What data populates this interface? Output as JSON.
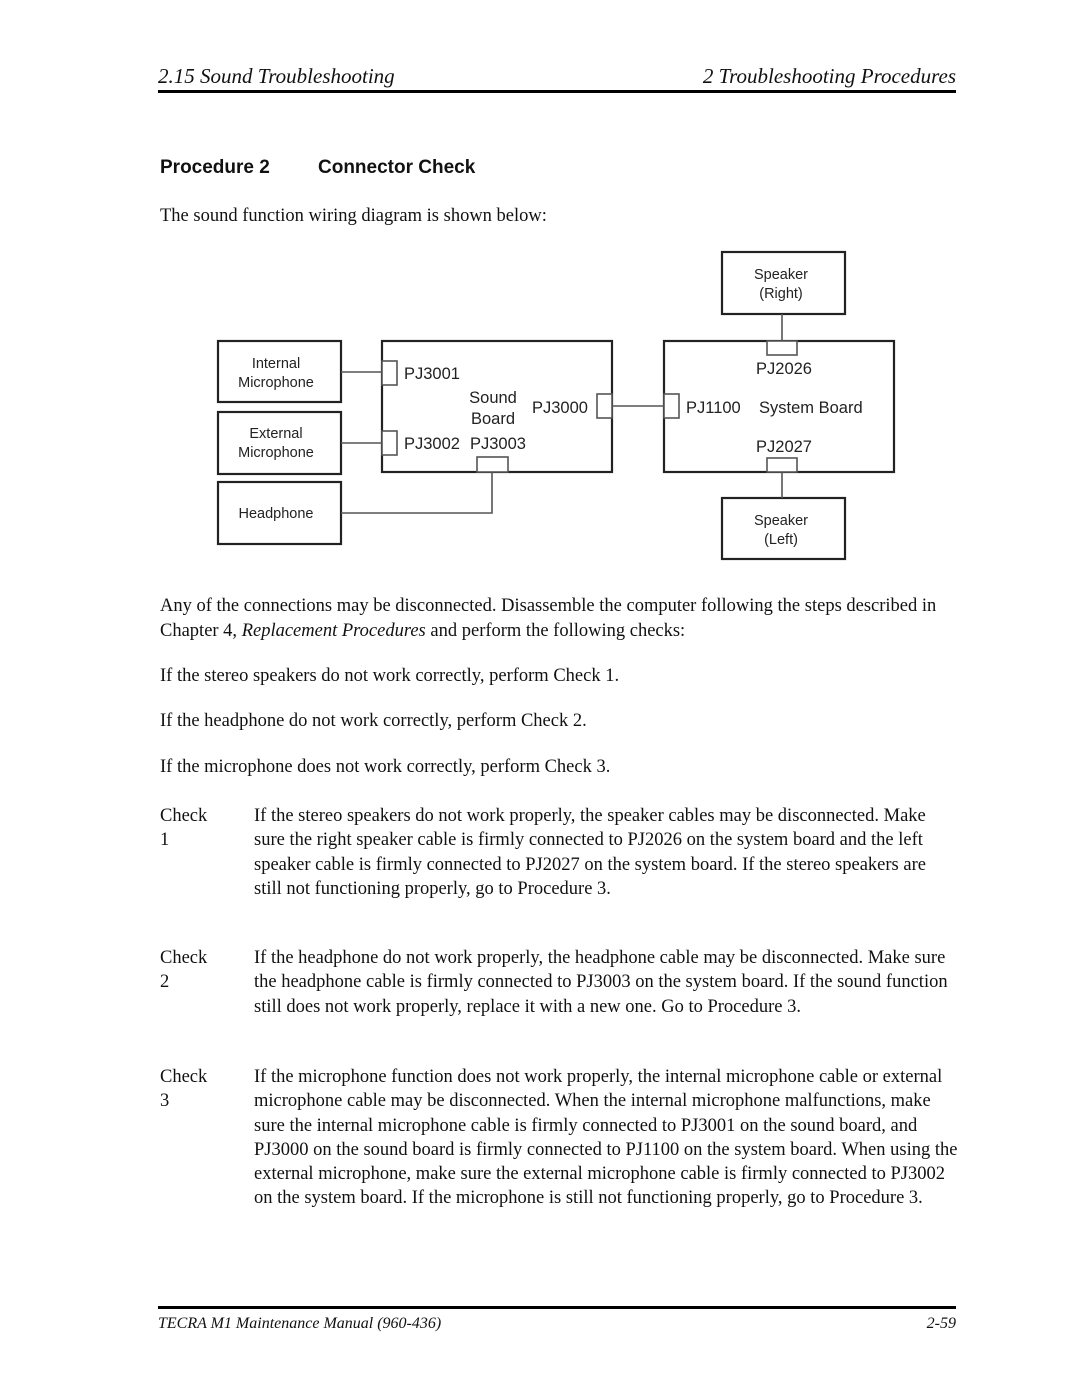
{
  "header": {
    "section": "2.15 Sound Troubleshooting",
    "chapter": "2  Troubleshooting Procedures"
  },
  "procedure": {
    "number": "Procedure 2",
    "title": "Connector Check"
  },
  "intro": "The sound function wiring diagram is shown below:",
  "diagram": {
    "devices": {
      "internal_mic": [
        "Internal",
        "Microphone"
      ],
      "external_mic": [
        "External",
        "Microphone"
      ],
      "headphone": [
        "Headphone"
      ],
      "speaker_right": [
        "Speaker",
        "(Right)"
      ],
      "speaker_left": [
        "Speaker",
        "(Left)"
      ]
    },
    "sound_board": {
      "name": [
        "Sound",
        "Board"
      ],
      "connectors": [
        "PJ3001",
        "PJ3002",
        "PJ3003",
        "PJ3000"
      ]
    },
    "system_board": {
      "name": "System Board",
      "connectors": [
        "PJ2026",
        "PJ1100",
        "PJ2027"
      ]
    }
  },
  "body": {
    "para1_a": "Any of the connections may be disconnected. Disassemble the computer following the steps described in Chapter 4, ",
    "para1_em": "Replacement Procedures",
    "para1_b": " and perform the following checks:",
    "line1": "If the stereo speakers do not work correctly, perform Check 1.",
    "line2": "If the headphone do not work correctly, perform Check 2.",
    "line3": "If the microphone does not work correctly, perform Check 3."
  },
  "checks": [
    {
      "label": "Check 1",
      "text": "If the stereo speakers do not work properly, the speaker cables may be disconnected. Make sure the right speaker cable is firmly connected to PJ2026 on the system board and the left speaker cable is firmly connected to PJ2027 on the system board. If the stereo speakers are still not functioning properly, go to Procedure 3."
    },
    {
      "label": "Check 2",
      "text": "If the headphone do not work properly, the headphone cable may be disconnected. Make sure the headphone cable is firmly connected to PJ3003 on the system board.  If the sound function still does not work properly, replace it with a new one. Go to Procedure 3."
    },
    {
      "label": "Check 3",
      "text": "If the microphone function does not work properly, the internal microphone cable or external microphone cable may be disconnected. When the internal microphone malfunctions, make sure the internal microphone cable is firmly connected to PJ3001 on the sound board, and PJ3000 on the sound board is firmly connected to PJ1100 on the system board. When using the external microphone, make sure the external microphone cable is firmly connected to PJ3002 on the system board. If the microphone is still not functioning properly, go to Procedure 3."
    }
  ],
  "footer": {
    "manual": "TECRA M1 Maintenance Manual (960-436)",
    "page": "2-59"
  }
}
